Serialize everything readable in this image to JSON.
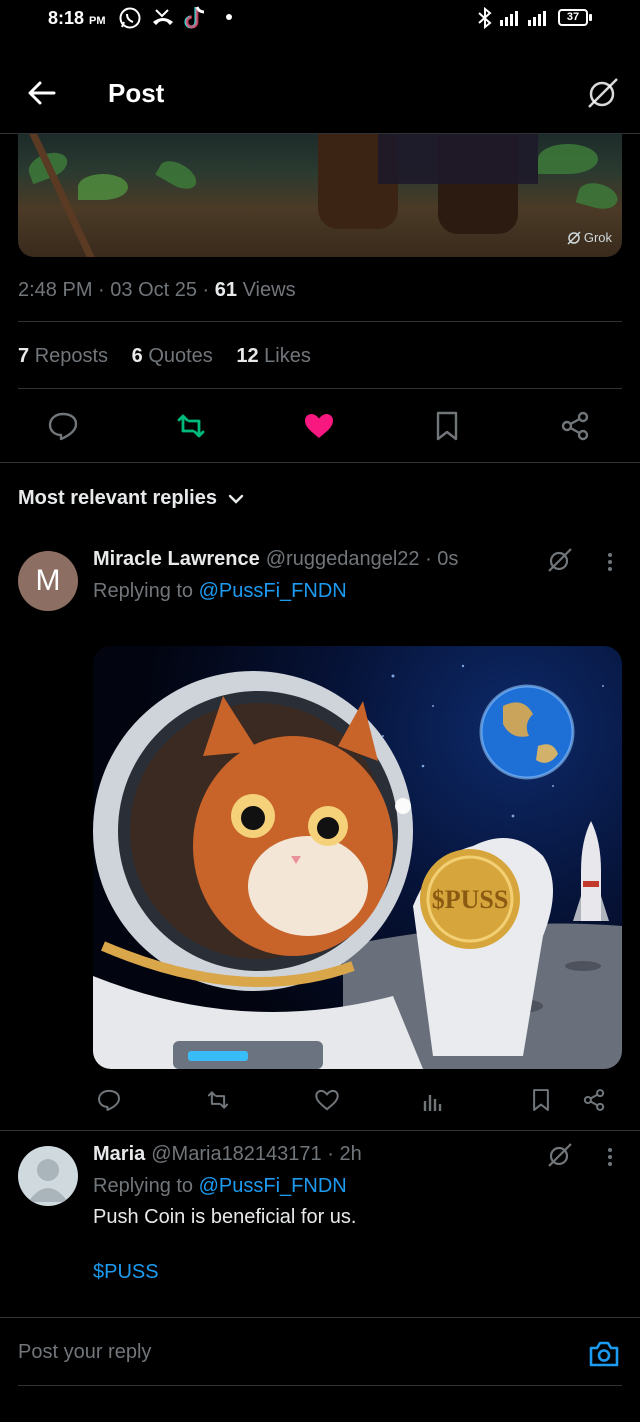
{
  "status_bar": {
    "time": "8:18",
    "ampm": "PM",
    "battery": "37"
  },
  "header": {
    "title": "Post"
  },
  "post": {
    "image_watermark": "Grok",
    "time": "2:48 PM",
    "date": "03 Oct 25",
    "views_count": "61",
    "views_label": "Views",
    "reposts_count": "7",
    "reposts_label": "Reposts",
    "quotes_count": "6",
    "quotes_label": "Quotes",
    "likes_count": "12",
    "likes_label": "Likes",
    "liked": true,
    "reposted": true
  },
  "replies_filter": {
    "label": "Most relevant replies"
  },
  "replies": [
    {
      "avatar_letter": "M",
      "name": "Miracle Lawrence",
      "handle": "@ruggedangel22",
      "time": "· 0s",
      "replying_prefix": "Replying to",
      "replying_to": "@PussFi_FNDN",
      "coin_text": "$PUSS"
    },
    {
      "name": "Maria",
      "handle": "@Maria182143171",
      "time": "· 2h",
      "replying_prefix": "Replying to",
      "replying_to": "@PussFi_FNDN",
      "text": "Push Coin is beneficial for us.",
      "cashtag": "$PUSS"
    }
  ],
  "reply_box": {
    "placeholder": "Post your reply"
  },
  "colors": {
    "accent": "#1d9bf0",
    "like": "#f91880",
    "repost": "#00ba7c",
    "muted": "#71767b"
  },
  "icons": [
    "arrow-left-icon",
    "grok-icon",
    "comment-icon",
    "repost-icon",
    "heart-icon",
    "bookmark-icon",
    "share-icon",
    "chevron-down-icon",
    "more-icon",
    "analytics-icon",
    "camera-icon"
  ]
}
